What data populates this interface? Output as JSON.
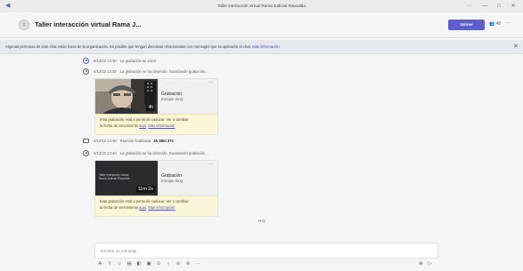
{
  "window": {
    "title": "Taller interacción virtual Rama Judicial Risaralda",
    "controls": [
      "—",
      "□",
      "✕"
    ],
    "extra_control": "···"
  },
  "header": {
    "avatar_icon": "people-icon",
    "title": "Taller interacción virtual Rama J...",
    "join_label": "Unirse",
    "people_label": "👥 46",
    "more_label": "···"
  },
  "banner": {
    "text": "Algunas personas de este chat están fuera de la organización. Es posible que tengan directivas relacionadas con mensajes que se aplicarán al chat. ",
    "link": "Más información",
    "close": "✕"
  },
  "events": [
    {
      "time": "6/12/22 14:30",
      "text": "La grabación se inició",
      "duration": ""
    },
    {
      "time": "6/12/22 14:30",
      "text": "La grabación se ha detenido. Guardando grabación...",
      "duration": ""
    },
    {
      "time": "6/12/22 14:40",
      "text": "Reunión finalizada:",
      "duration": "4h 38m 37s"
    },
    {
      "time": "6/12/22 14:40",
      "text": "La grabación se ha detenido. Guardando grabación...",
      "duration": ""
    }
  ],
  "recordings": [
    {
      "title": "Grabación",
      "author": "Enrique King",
      "more": "···",
      "duration": "4h",
      "warning_line1": "Esta grabación está a punto de caducar. Ver o cambiar",
      "warning_line2": "la fecha de vencimiento ",
      "warning_link1": "aquí",
      "warning_link2": "Más información"
    },
    {
      "title": "Grabación",
      "author": "Enrique King",
      "more": "···",
      "duration": "11m 2s",
      "thumb_text": "Taller interacción virtual Rama Judicial Risaralda",
      "warning_line1": "Esta grabación está a punto de caducar. Ver o cambiar",
      "warning_line2": "la fecha de vencimiento ",
      "warning_link1": "aquí",
      "warning_link2": "Más información"
    }
  ],
  "day_separator": "Hoy",
  "compose": {
    "placeholder": "Escribe un mensaje"
  },
  "toolbar": {
    "icons": [
      "format-icon",
      "attach-icon",
      "emoji-icon",
      "gif-icon",
      "sticker-icon",
      "meet-icon",
      "schedule-icon",
      "praise-icon",
      "loop-icon",
      "approvals-icon",
      "more-icon"
    ],
    "glyphs": [
      "A̷",
      "⇧",
      "☺",
      "▤",
      "◧",
      "▣",
      "⊙",
      "♀",
      "⊘",
      "⊛",
      "···"
    ],
    "send_icons": [
      "reaction-icon",
      "send-icon"
    ],
    "send_glyphs": [
      "⊕",
      "▷"
    ]
  }
}
